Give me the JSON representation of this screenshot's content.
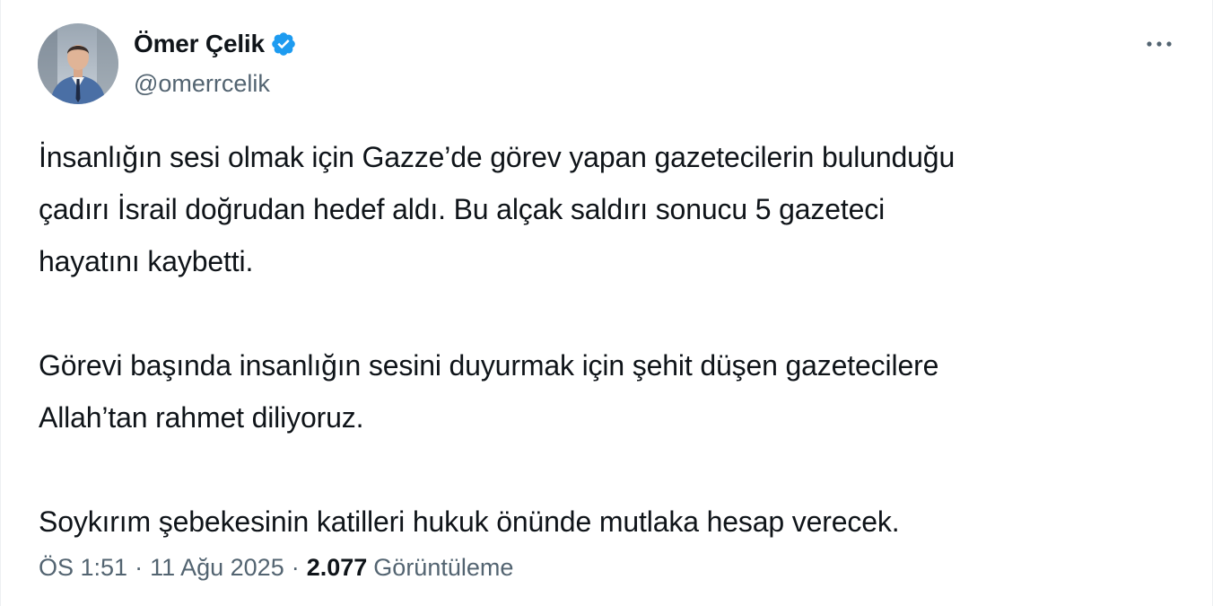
{
  "author": {
    "display_name": "Ömer Çelik",
    "handle": "@omerrcelik",
    "verified": true,
    "verified_color": "#1d9bf0",
    "avatar_icon": "profile-photo"
  },
  "more_icon": "more-horizontal-icon",
  "tweet": {
    "lines": [
      "İnsanlığın sesi olmak için Gazze’de görev yapan gazetecilerin bulunduğu",
      "çadırı İsrail doğrudan hedef aldı. Bu alçak saldırı sonucu 5 gazeteci",
      "hayatını kaybetti.",
      "Görevi başında insanlığın sesini duyurmak için şehit düşen gazetecilere",
      "Allah’tan rahmet diliyoruz.",
      "Soykırım şebekesinin katilleri hukuk önünde mutlaka hesap verecek."
    ]
  },
  "meta": {
    "time": "ÖS 1:51",
    "separator": "·",
    "date": "11 Ağu 2025",
    "views_count": "2.077",
    "views_label": "Görüntüleme"
  },
  "colors": {
    "text": "#0f1419",
    "secondary": "#536471",
    "accent": "#1d9bf0"
  }
}
